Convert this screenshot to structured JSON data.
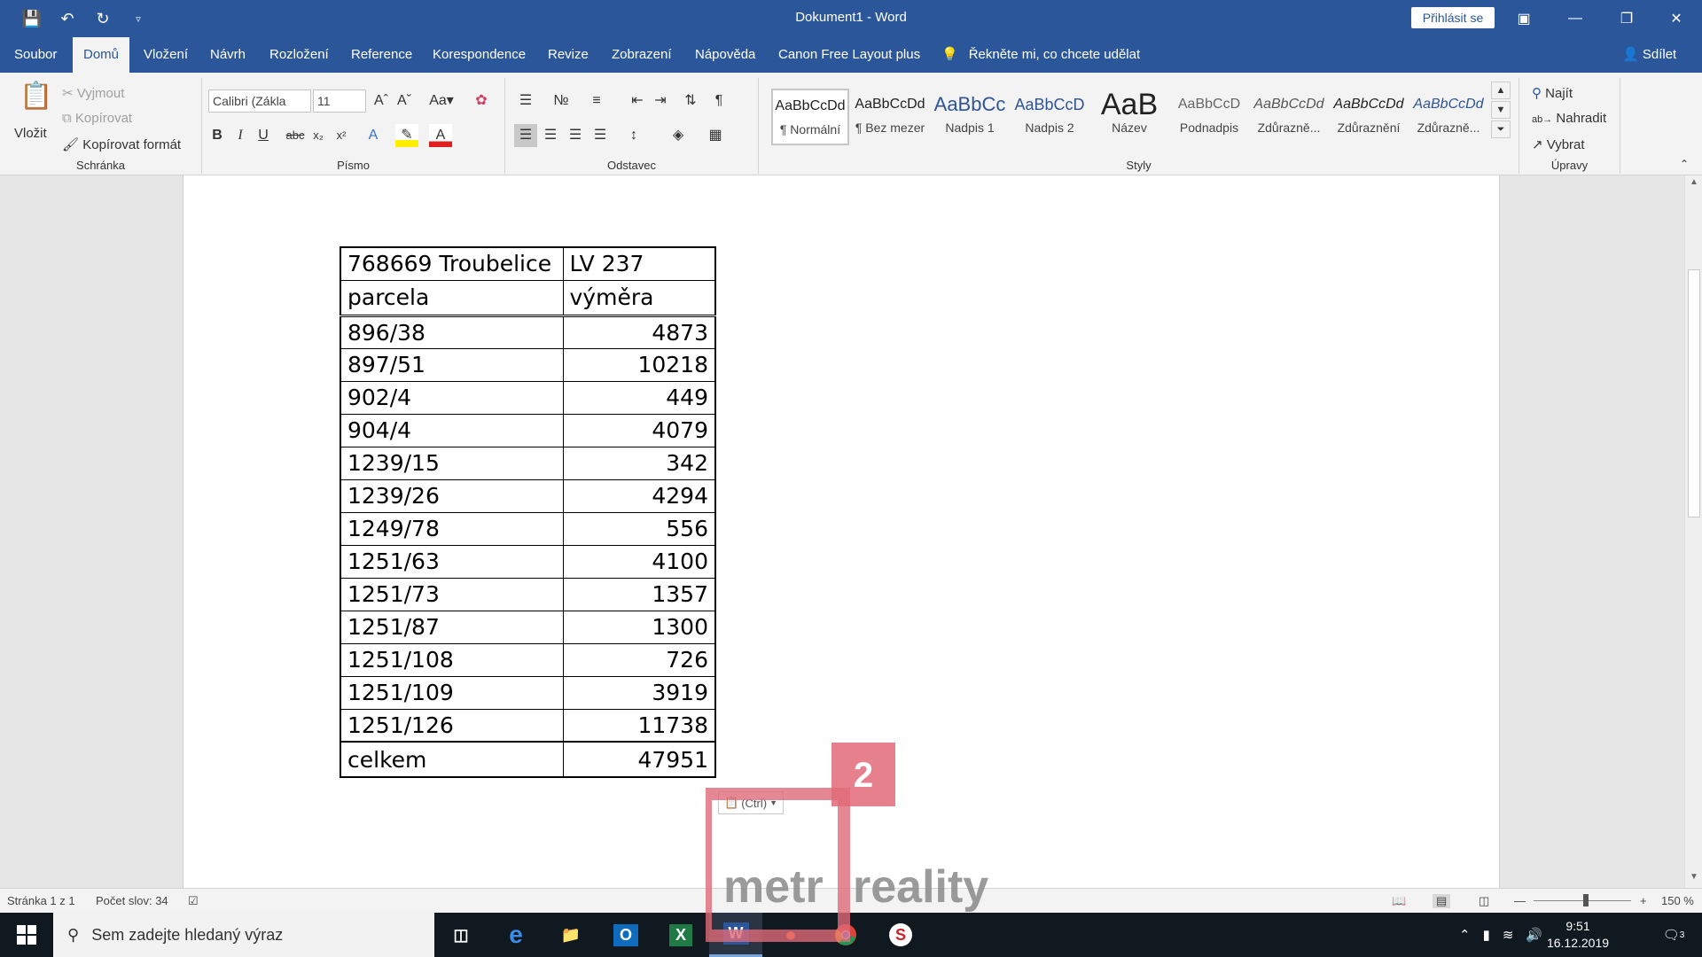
{
  "app": {
    "title": "Dokument1  -  Word",
    "signin_label": "Přihlásit se",
    "share_label": "Sdílet",
    "tell_me": "Řekněte mi, co chcete udělat"
  },
  "tabs": [
    "Soubor",
    "Domů",
    "Vložení",
    "Návrh",
    "Rozložení",
    "Reference",
    "Korespondence",
    "Revize",
    "Zobrazení",
    "Nápověda",
    "Canon Free Layout plus"
  ],
  "ribbon": {
    "clipboard": {
      "paste": "Vložit",
      "cut": "Vyjmout",
      "copy": "Kopírovat",
      "format_painter": "Kopírovat formát",
      "group": "Schránka"
    },
    "font": {
      "name": "Calibri (Zákla",
      "size": "11",
      "group": "Písmo"
    },
    "paragraph": {
      "group": "Odstavec"
    },
    "styles": {
      "group": "Styly",
      "items": [
        {
          "preview": "AaBbCcDd",
          "name": "¶ Normální"
        },
        {
          "preview": "AaBbCcDd",
          "name": "¶ Bez mezer"
        },
        {
          "preview": "AaBbCc",
          "name": "Nadpis 1"
        },
        {
          "preview": "AaBbCcD",
          "name": "Nadpis 2"
        },
        {
          "preview": "AaB",
          "name": "Název"
        },
        {
          "preview": "AaBbCcD",
          "name": "Podnadpis"
        },
        {
          "preview": "AaBbCcDd",
          "name": "Zdůrazně..."
        },
        {
          "preview": "AaBbCcDd",
          "name": "Zdůraznění"
        },
        {
          "preview": "AaBbCcDd",
          "name": "Zdůrazně..."
        }
      ]
    },
    "editing": {
      "find": "Najít",
      "replace": "Nahradit",
      "select": "Vybrat",
      "group": "Úpravy"
    }
  },
  "table": {
    "header": [
      [
        "768669 Troubelice",
        "LV 237"
      ],
      [
        "parcela",
        "výměra"
      ]
    ],
    "rows": [
      [
        "896/38",
        "4873"
      ],
      [
        "897/51",
        "10218"
      ],
      [
        "902/4",
        "449"
      ],
      [
        "904/4",
        "4079"
      ],
      [
        "1239/15",
        "342"
      ],
      [
        "1239/26",
        "4294"
      ],
      [
        "1249/78",
        "556"
      ],
      [
        "1251/63",
        "4100"
      ],
      [
        "1251/73",
        "1357"
      ],
      [
        "1251/87",
        "1300"
      ],
      [
        "1251/108",
        "726"
      ],
      [
        "1251/109",
        "3919"
      ],
      [
        "1251/126",
        "11738"
      ]
    ],
    "total": [
      "celkem",
      "47951"
    ]
  },
  "paste_options": "(Ctrl)",
  "status": {
    "page": "Stránka 1 z 1",
    "words": "Počet slov: 34",
    "zoom": "150 %"
  },
  "taskbar": {
    "search_placeholder": "Sem zadejte hledaný výraz",
    "time": "9:51",
    "date": "16.12.2019",
    "notifications": "3"
  },
  "watermark": {
    "badge": "2",
    "text_left": "metr",
    "text_right": "reality"
  },
  "colors": {
    "word_blue": "#2b579a",
    "watermark_red": "#e06a78"
  }
}
